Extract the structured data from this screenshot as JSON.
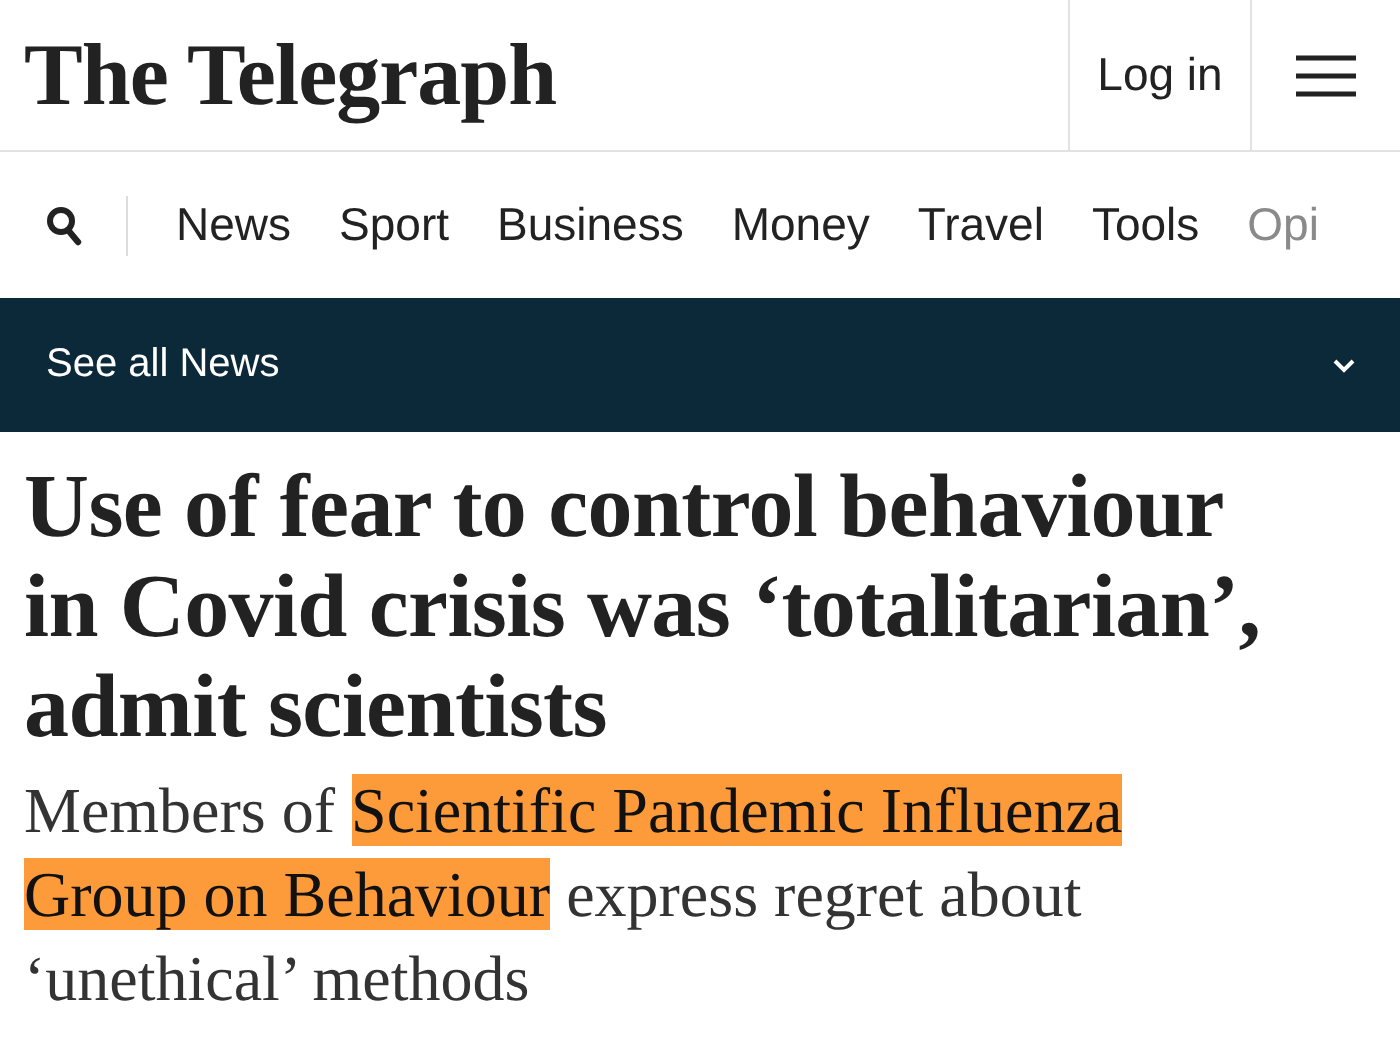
{
  "header": {
    "logo": "The Telegraph",
    "login": "Log in"
  },
  "nav": {
    "items": [
      {
        "label": "News",
        "faded": false
      },
      {
        "label": "Sport",
        "faded": false
      },
      {
        "label": "Business",
        "faded": false
      },
      {
        "label": "Money",
        "faded": false
      },
      {
        "label": "Travel",
        "faded": false
      },
      {
        "label": "Tools",
        "faded": false
      },
      {
        "label": "Opi",
        "faded": true
      }
    ]
  },
  "section_bar": {
    "label": "See all News",
    "expanded": false
  },
  "article": {
    "headline": "Use of fear to control behaviour in Covid crisis was ‘totalitarian’, admit scientists",
    "standfirst": [
      {
        "text": "Members of ",
        "highlighted": false
      },
      {
        "text": "Scientific Pandemic Influenza Group on Behaviour",
        "highlighted": true
      },
      {
        "text": " express regret about ‘unethical’ methods",
        "highlighted": false
      }
    ]
  }
}
